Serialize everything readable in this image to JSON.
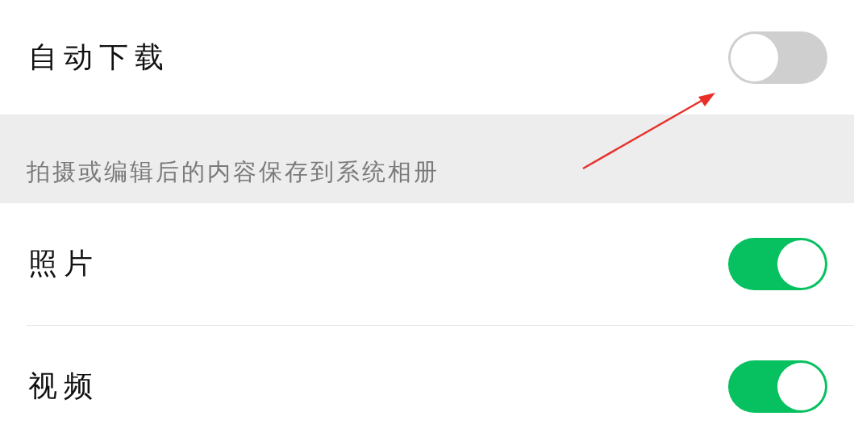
{
  "sections": [
    {
      "kind": "rows",
      "rows": [
        {
          "label": "自动下载",
          "on": false
        }
      ]
    },
    {
      "kind": "header",
      "text": "拍摄或编辑后的内容保存到系统相册"
    },
    {
      "kind": "rows",
      "rows": [
        {
          "label": "照片",
          "on": true
        },
        {
          "label": "视频",
          "on": true
        }
      ]
    }
  ],
  "annotations": [
    {
      "kind": "arrow"
    }
  ]
}
